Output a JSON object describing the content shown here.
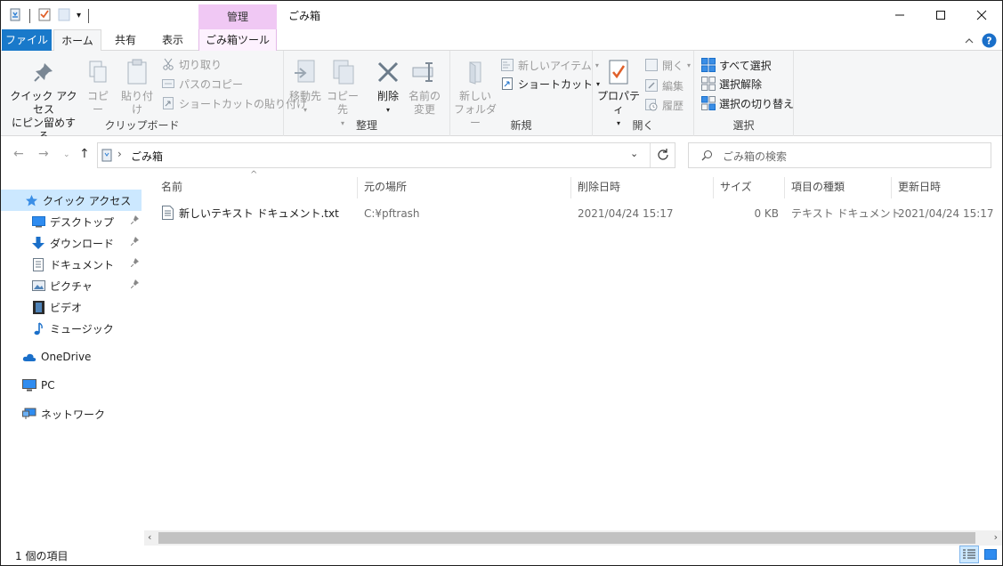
{
  "window": {
    "title": "ごみ箱",
    "context_group": "管理",
    "controls": {
      "minimize": "—",
      "maximize": "☐",
      "close": "✕"
    }
  },
  "tabs": {
    "file": "ファイル",
    "home": "ホーム",
    "share": "共有",
    "view": "表示",
    "tools": "ごみ箱ツール"
  },
  "ribbon": {
    "clipboard": {
      "label": "クリップボード",
      "pin_line1": "クイック アクセス",
      "pin_line2": "にピン留めする",
      "copy": "コピー",
      "paste": "貼り付け",
      "cut": "切り取り",
      "copy_path": "パスのコピー",
      "paste_shortcut": "ショートカットの貼り付け"
    },
    "organize": {
      "label": "整理",
      "move_to": "移動先",
      "copy_to": "コピー先",
      "delete": "削除",
      "rename_line1": "名前の",
      "rename_line2": "変更"
    },
    "new": {
      "label": "新規",
      "new_folder_line1": "新しい",
      "new_folder_line2": "フォルダー",
      "new_item": "新しいアイテム",
      "shortcut": "ショートカット"
    },
    "open": {
      "label": "開く",
      "properties": "プロパティ",
      "open": "開く",
      "edit": "編集",
      "history": "履歴"
    },
    "select": {
      "label": "選択",
      "select_all": "すべて選択",
      "select_none": "選択解除",
      "invert": "選択の切り替え"
    }
  },
  "address": {
    "path": "ごみ箱",
    "search_placeholder": "ごみ箱の検索"
  },
  "nav": {
    "quick_access": "クイック アクセス",
    "desktop": "デスクトップ",
    "downloads": "ダウンロード",
    "documents": "ドキュメント",
    "pictures": "ピクチャ",
    "videos": "ビデオ",
    "music": "ミュージック",
    "onedrive": "OneDrive",
    "pc": "PC",
    "network": "ネットワーク"
  },
  "columns": {
    "name": "名前",
    "original_location": "元の場所",
    "date_deleted": "削除日時",
    "size": "サイズ",
    "item_type": "項目の種類",
    "date_modified": "更新日時"
  },
  "files": [
    {
      "name": "新しいテキスト ドキュメント.txt",
      "original_location": "C:¥pftrash",
      "date_deleted": "2021/04/24 15:17",
      "size": "0 KB",
      "item_type": "テキスト ドキュメント",
      "date_modified": "2021/04/24 15:17"
    }
  ],
  "status": {
    "count": "1 個の項目"
  },
  "colors": {
    "accent": "#1979ca",
    "context_tab": "#f0c8f4",
    "selection": "#cce8ff"
  }
}
